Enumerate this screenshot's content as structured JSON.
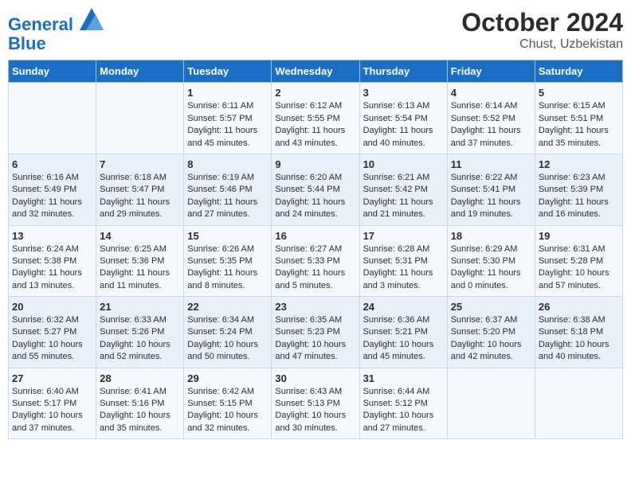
{
  "header": {
    "logo_line1": "General",
    "logo_line2": "Blue",
    "month": "October 2024",
    "location": "Chust, Uzbekistan"
  },
  "weekdays": [
    "Sunday",
    "Monday",
    "Tuesday",
    "Wednesday",
    "Thursday",
    "Friday",
    "Saturday"
  ],
  "weeks": [
    [
      {
        "day": "",
        "info": ""
      },
      {
        "day": "",
        "info": ""
      },
      {
        "day": "1",
        "info": "Sunrise: 6:11 AM\nSunset: 5:57 PM\nDaylight: 11 hours and 45 minutes."
      },
      {
        "day": "2",
        "info": "Sunrise: 6:12 AM\nSunset: 5:55 PM\nDaylight: 11 hours and 43 minutes."
      },
      {
        "day": "3",
        "info": "Sunrise: 6:13 AM\nSunset: 5:54 PM\nDaylight: 11 hours and 40 minutes."
      },
      {
        "day": "4",
        "info": "Sunrise: 6:14 AM\nSunset: 5:52 PM\nDaylight: 11 hours and 37 minutes."
      },
      {
        "day": "5",
        "info": "Sunrise: 6:15 AM\nSunset: 5:51 PM\nDaylight: 11 hours and 35 minutes."
      }
    ],
    [
      {
        "day": "6",
        "info": "Sunrise: 6:16 AM\nSunset: 5:49 PM\nDaylight: 11 hours and 32 minutes."
      },
      {
        "day": "7",
        "info": "Sunrise: 6:18 AM\nSunset: 5:47 PM\nDaylight: 11 hours and 29 minutes."
      },
      {
        "day": "8",
        "info": "Sunrise: 6:19 AM\nSunset: 5:46 PM\nDaylight: 11 hours and 27 minutes."
      },
      {
        "day": "9",
        "info": "Sunrise: 6:20 AM\nSunset: 5:44 PM\nDaylight: 11 hours and 24 minutes."
      },
      {
        "day": "10",
        "info": "Sunrise: 6:21 AM\nSunset: 5:42 PM\nDaylight: 11 hours and 21 minutes."
      },
      {
        "day": "11",
        "info": "Sunrise: 6:22 AM\nSunset: 5:41 PM\nDaylight: 11 hours and 19 minutes."
      },
      {
        "day": "12",
        "info": "Sunrise: 6:23 AM\nSunset: 5:39 PM\nDaylight: 11 hours and 16 minutes."
      }
    ],
    [
      {
        "day": "13",
        "info": "Sunrise: 6:24 AM\nSunset: 5:38 PM\nDaylight: 11 hours and 13 minutes."
      },
      {
        "day": "14",
        "info": "Sunrise: 6:25 AM\nSunset: 5:36 PM\nDaylight: 11 hours and 11 minutes."
      },
      {
        "day": "15",
        "info": "Sunrise: 6:26 AM\nSunset: 5:35 PM\nDaylight: 11 hours and 8 minutes."
      },
      {
        "day": "16",
        "info": "Sunrise: 6:27 AM\nSunset: 5:33 PM\nDaylight: 11 hours and 5 minutes."
      },
      {
        "day": "17",
        "info": "Sunrise: 6:28 AM\nSunset: 5:31 PM\nDaylight: 11 hours and 3 minutes."
      },
      {
        "day": "18",
        "info": "Sunrise: 6:29 AM\nSunset: 5:30 PM\nDaylight: 11 hours and 0 minutes."
      },
      {
        "day": "19",
        "info": "Sunrise: 6:31 AM\nSunset: 5:28 PM\nDaylight: 10 hours and 57 minutes."
      }
    ],
    [
      {
        "day": "20",
        "info": "Sunrise: 6:32 AM\nSunset: 5:27 PM\nDaylight: 10 hours and 55 minutes."
      },
      {
        "day": "21",
        "info": "Sunrise: 6:33 AM\nSunset: 5:26 PM\nDaylight: 10 hours and 52 minutes."
      },
      {
        "day": "22",
        "info": "Sunrise: 6:34 AM\nSunset: 5:24 PM\nDaylight: 10 hours and 50 minutes."
      },
      {
        "day": "23",
        "info": "Sunrise: 6:35 AM\nSunset: 5:23 PM\nDaylight: 10 hours and 47 minutes."
      },
      {
        "day": "24",
        "info": "Sunrise: 6:36 AM\nSunset: 5:21 PM\nDaylight: 10 hours and 45 minutes."
      },
      {
        "day": "25",
        "info": "Sunrise: 6:37 AM\nSunset: 5:20 PM\nDaylight: 10 hours and 42 minutes."
      },
      {
        "day": "26",
        "info": "Sunrise: 6:38 AM\nSunset: 5:18 PM\nDaylight: 10 hours and 40 minutes."
      }
    ],
    [
      {
        "day": "27",
        "info": "Sunrise: 6:40 AM\nSunset: 5:17 PM\nDaylight: 10 hours and 37 minutes."
      },
      {
        "day": "28",
        "info": "Sunrise: 6:41 AM\nSunset: 5:16 PM\nDaylight: 10 hours and 35 minutes."
      },
      {
        "day": "29",
        "info": "Sunrise: 6:42 AM\nSunset: 5:15 PM\nDaylight: 10 hours and 32 minutes."
      },
      {
        "day": "30",
        "info": "Sunrise: 6:43 AM\nSunset: 5:13 PM\nDaylight: 10 hours and 30 minutes."
      },
      {
        "day": "31",
        "info": "Sunrise: 6:44 AM\nSunset: 5:12 PM\nDaylight: 10 hours and 27 minutes."
      },
      {
        "day": "",
        "info": ""
      },
      {
        "day": "",
        "info": ""
      }
    ]
  ]
}
